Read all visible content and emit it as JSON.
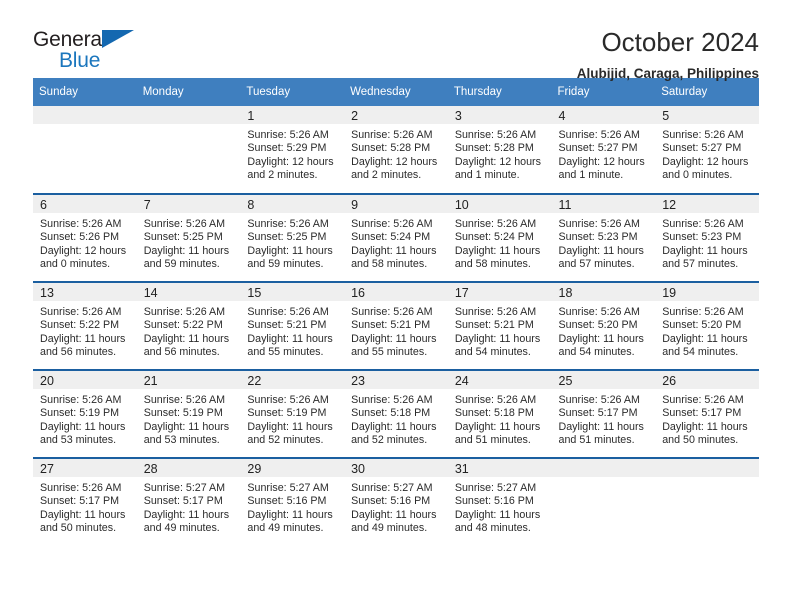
{
  "logo": {
    "text_top": "General",
    "text_bottom": "Blue",
    "triangle_color": "#1468b0",
    "blue_color": "#1b76bd"
  },
  "header": {
    "title": "October 2024",
    "subtitle": "Alubijid, Caraga, Philippines"
  },
  "theme": {
    "header_bg": "#3f7fbf",
    "row_border": "#1b5fa0",
    "daynum_bg": "#efefef"
  },
  "weekday_headers": [
    "Sunday",
    "Monday",
    "Tuesday",
    "Wednesday",
    "Thursday",
    "Friday",
    "Saturday"
  ],
  "weeks": [
    [
      {
        "day": "",
        "sunrise": "",
        "sunset": "",
        "daylight": ""
      },
      {
        "day": "",
        "sunrise": "",
        "sunset": "",
        "daylight": ""
      },
      {
        "day": "1",
        "sunrise": "Sunrise: 5:26 AM",
        "sunset": "Sunset: 5:29 PM",
        "daylight": "Daylight: 12 hours and 2 minutes."
      },
      {
        "day": "2",
        "sunrise": "Sunrise: 5:26 AM",
        "sunset": "Sunset: 5:28 PM",
        "daylight": "Daylight: 12 hours and 2 minutes."
      },
      {
        "day": "3",
        "sunrise": "Sunrise: 5:26 AM",
        "sunset": "Sunset: 5:28 PM",
        "daylight": "Daylight: 12 hours and 1 minute."
      },
      {
        "day": "4",
        "sunrise": "Sunrise: 5:26 AM",
        "sunset": "Sunset: 5:27 PM",
        "daylight": "Daylight: 12 hours and 1 minute."
      },
      {
        "day": "5",
        "sunrise": "Sunrise: 5:26 AM",
        "sunset": "Sunset: 5:27 PM",
        "daylight": "Daylight: 12 hours and 0 minutes."
      }
    ],
    [
      {
        "day": "6",
        "sunrise": "Sunrise: 5:26 AM",
        "sunset": "Sunset: 5:26 PM",
        "daylight": "Daylight: 12 hours and 0 minutes."
      },
      {
        "day": "7",
        "sunrise": "Sunrise: 5:26 AM",
        "sunset": "Sunset: 5:25 PM",
        "daylight": "Daylight: 11 hours and 59 minutes."
      },
      {
        "day": "8",
        "sunrise": "Sunrise: 5:26 AM",
        "sunset": "Sunset: 5:25 PM",
        "daylight": "Daylight: 11 hours and 59 minutes."
      },
      {
        "day": "9",
        "sunrise": "Sunrise: 5:26 AM",
        "sunset": "Sunset: 5:24 PM",
        "daylight": "Daylight: 11 hours and 58 minutes."
      },
      {
        "day": "10",
        "sunrise": "Sunrise: 5:26 AM",
        "sunset": "Sunset: 5:24 PM",
        "daylight": "Daylight: 11 hours and 58 minutes."
      },
      {
        "day": "11",
        "sunrise": "Sunrise: 5:26 AM",
        "sunset": "Sunset: 5:23 PM",
        "daylight": "Daylight: 11 hours and 57 minutes."
      },
      {
        "day": "12",
        "sunrise": "Sunrise: 5:26 AM",
        "sunset": "Sunset: 5:23 PM",
        "daylight": "Daylight: 11 hours and 57 minutes."
      }
    ],
    [
      {
        "day": "13",
        "sunrise": "Sunrise: 5:26 AM",
        "sunset": "Sunset: 5:22 PM",
        "daylight": "Daylight: 11 hours and 56 minutes."
      },
      {
        "day": "14",
        "sunrise": "Sunrise: 5:26 AM",
        "sunset": "Sunset: 5:22 PM",
        "daylight": "Daylight: 11 hours and 56 minutes."
      },
      {
        "day": "15",
        "sunrise": "Sunrise: 5:26 AM",
        "sunset": "Sunset: 5:21 PM",
        "daylight": "Daylight: 11 hours and 55 minutes."
      },
      {
        "day": "16",
        "sunrise": "Sunrise: 5:26 AM",
        "sunset": "Sunset: 5:21 PM",
        "daylight": "Daylight: 11 hours and 55 minutes."
      },
      {
        "day": "17",
        "sunrise": "Sunrise: 5:26 AM",
        "sunset": "Sunset: 5:21 PM",
        "daylight": "Daylight: 11 hours and 54 minutes."
      },
      {
        "day": "18",
        "sunrise": "Sunrise: 5:26 AM",
        "sunset": "Sunset: 5:20 PM",
        "daylight": "Daylight: 11 hours and 54 minutes."
      },
      {
        "day": "19",
        "sunrise": "Sunrise: 5:26 AM",
        "sunset": "Sunset: 5:20 PM",
        "daylight": "Daylight: 11 hours and 54 minutes."
      }
    ],
    [
      {
        "day": "20",
        "sunrise": "Sunrise: 5:26 AM",
        "sunset": "Sunset: 5:19 PM",
        "daylight": "Daylight: 11 hours and 53 minutes."
      },
      {
        "day": "21",
        "sunrise": "Sunrise: 5:26 AM",
        "sunset": "Sunset: 5:19 PM",
        "daylight": "Daylight: 11 hours and 53 minutes."
      },
      {
        "day": "22",
        "sunrise": "Sunrise: 5:26 AM",
        "sunset": "Sunset: 5:19 PM",
        "daylight": "Daylight: 11 hours and 52 minutes."
      },
      {
        "day": "23",
        "sunrise": "Sunrise: 5:26 AM",
        "sunset": "Sunset: 5:18 PM",
        "daylight": "Daylight: 11 hours and 52 minutes."
      },
      {
        "day": "24",
        "sunrise": "Sunrise: 5:26 AM",
        "sunset": "Sunset: 5:18 PM",
        "daylight": "Daylight: 11 hours and 51 minutes."
      },
      {
        "day": "25",
        "sunrise": "Sunrise: 5:26 AM",
        "sunset": "Sunset: 5:17 PM",
        "daylight": "Daylight: 11 hours and 51 minutes."
      },
      {
        "day": "26",
        "sunrise": "Sunrise: 5:26 AM",
        "sunset": "Sunset: 5:17 PM",
        "daylight": "Daylight: 11 hours and 50 minutes."
      }
    ],
    [
      {
        "day": "27",
        "sunrise": "Sunrise: 5:26 AM",
        "sunset": "Sunset: 5:17 PM",
        "daylight": "Daylight: 11 hours and 50 minutes."
      },
      {
        "day": "28",
        "sunrise": "Sunrise: 5:27 AM",
        "sunset": "Sunset: 5:17 PM",
        "daylight": "Daylight: 11 hours and 49 minutes."
      },
      {
        "day": "29",
        "sunrise": "Sunrise: 5:27 AM",
        "sunset": "Sunset: 5:16 PM",
        "daylight": "Daylight: 11 hours and 49 minutes."
      },
      {
        "day": "30",
        "sunrise": "Sunrise: 5:27 AM",
        "sunset": "Sunset: 5:16 PM",
        "daylight": "Daylight: 11 hours and 49 minutes."
      },
      {
        "day": "31",
        "sunrise": "Sunrise: 5:27 AM",
        "sunset": "Sunset: 5:16 PM",
        "daylight": "Daylight: 11 hours and 48 minutes."
      },
      {
        "day": "",
        "sunrise": "",
        "sunset": "",
        "daylight": ""
      },
      {
        "day": "",
        "sunrise": "",
        "sunset": "",
        "daylight": ""
      }
    ]
  ]
}
